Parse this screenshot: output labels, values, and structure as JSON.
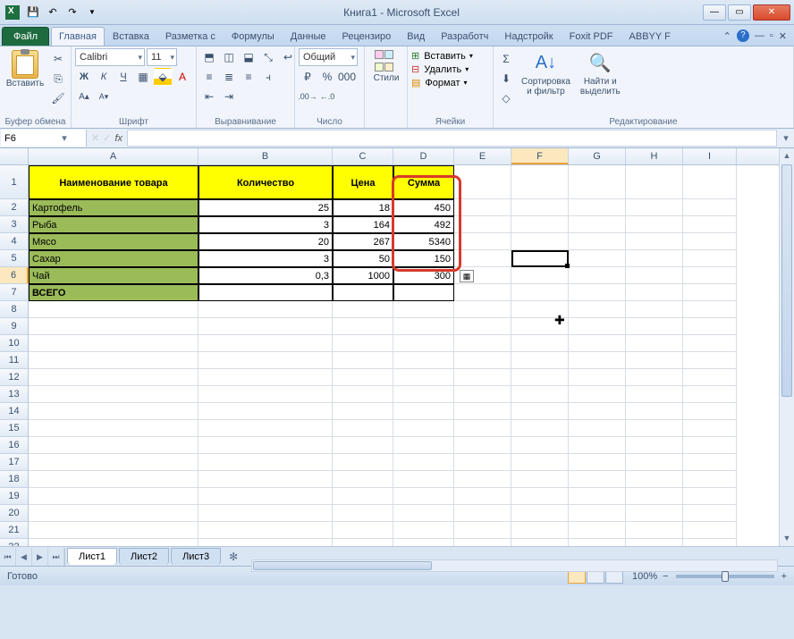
{
  "title": "Книга1 - Microsoft Excel",
  "tabs": {
    "file": "Файл",
    "items": [
      "Главная",
      "Вставка",
      "Разметка с",
      "Формулы",
      "Данные",
      "Рецензиро",
      "Вид",
      "Разработч",
      "Надстройк",
      "Foxit PDF",
      "ABBYY F"
    ],
    "active": 0
  },
  "ribbon": {
    "clipboard": {
      "paste": "Вставить",
      "label": "Буфер обмена"
    },
    "font": {
      "name": "Calibri",
      "size": "11",
      "label": "Шрифт"
    },
    "alignment": {
      "label": "Выравнивание"
    },
    "number": {
      "format": "Общий",
      "label": "Число"
    },
    "styles": {
      "btn": "Стили",
      "label": ""
    },
    "cells": {
      "insert": "Вставить",
      "delete": "Удалить",
      "format": "Формат",
      "label": "Ячейки"
    },
    "editing": {
      "sort": "Сортировка\nи фильтр",
      "find": "Найти и\nвыделить",
      "label": "Редактирование"
    }
  },
  "namebox": "F6",
  "columns": [
    "A",
    "B",
    "C",
    "D",
    "E",
    "F",
    "G",
    "H",
    "I"
  ],
  "colwidths": [
    "cA",
    "cB",
    "cC",
    "cD",
    "cE",
    "cF",
    "cG",
    "cH",
    "cI"
  ],
  "header_row": [
    "Наименование товара",
    "Количество",
    "Цена",
    "Сумма"
  ],
  "data_rows": [
    {
      "name": "Картофель",
      "qty": "25",
      "price": "18",
      "sum": "450"
    },
    {
      "name": "Рыба",
      "qty": "3",
      "price": "164",
      "sum": "492"
    },
    {
      "name": "Мясо",
      "qty": "20",
      "price": "267",
      "sum": "5340"
    },
    {
      "name": "Сахар",
      "qty": "3",
      "price": "50",
      "sum": "150"
    },
    {
      "name": "Чай",
      "qty": "0,3",
      "price": "1000",
      "sum": "300"
    }
  ],
  "total_label": "ВСЕГО",
  "sheets": [
    "Лист1",
    "Лист2",
    "Лист3"
  ],
  "active_sheet": 0,
  "status": {
    "ready": "Готово",
    "zoom": "100%"
  },
  "chart_data": {
    "type": "table",
    "columns": [
      "Наименование товара",
      "Количество",
      "Цена",
      "Сумма"
    ],
    "rows": [
      [
        "Картофель",
        25,
        18,
        450
      ],
      [
        "Рыба",
        3,
        164,
        492
      ],
      [
        "Мясо",
        20,
        267,
        5340
      ],
      [
        "Сахар",
        3,
        50,
        150
      ],
      [
        "Чай",
        0.3,
        1000,
        300
      ]
    ],
    "total_row_label": "ВСЕГО"
  }
}
